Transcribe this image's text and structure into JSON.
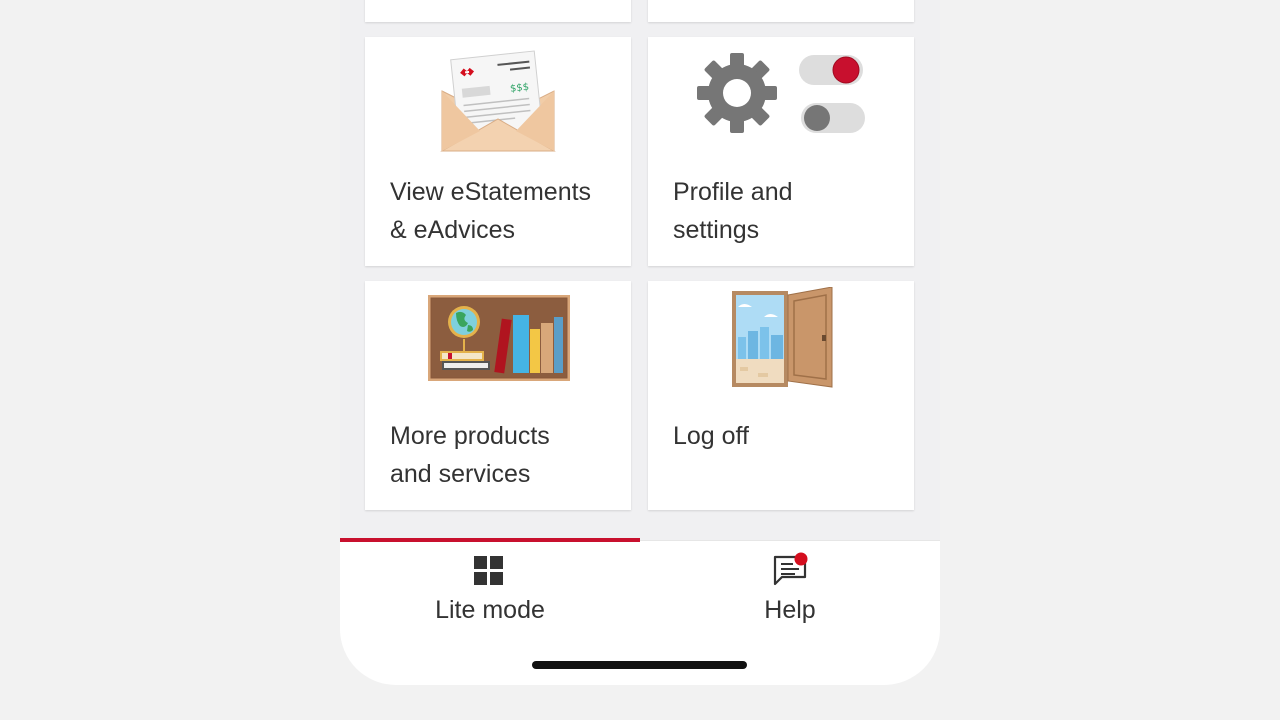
{
  "tiles": [
    {
      "label_line1": "View eStatements",
      "label_line2": "& eAdvices",
      "icon": "envelope-statement-icon"
    },
    {
      "label_line1": "Profile and",
      "label_line2": "settings",
      "icon": "gear-toggles-icon"
    },
    {
      "label_line1": "More products",
      "label_line2": "and services",
      "icon": "bookshelf-icon"
    },
    {
      "label_line1": "Log off",
      "label_line2": "",
      "icon": "open-door-icon"
    }
  ],
  "statement_amount": "$$$",
  "bottom_nav": {
    "lite_mode_label": "Lite mode",
    "help_label": "Help"
  },
  "colors": {
    "accent": "#c8102e",
    "background": "#f0f0f2",
    "tile": "#ffffff",
    "text": "#333333",
    "gear": "#767676"
  }
}
